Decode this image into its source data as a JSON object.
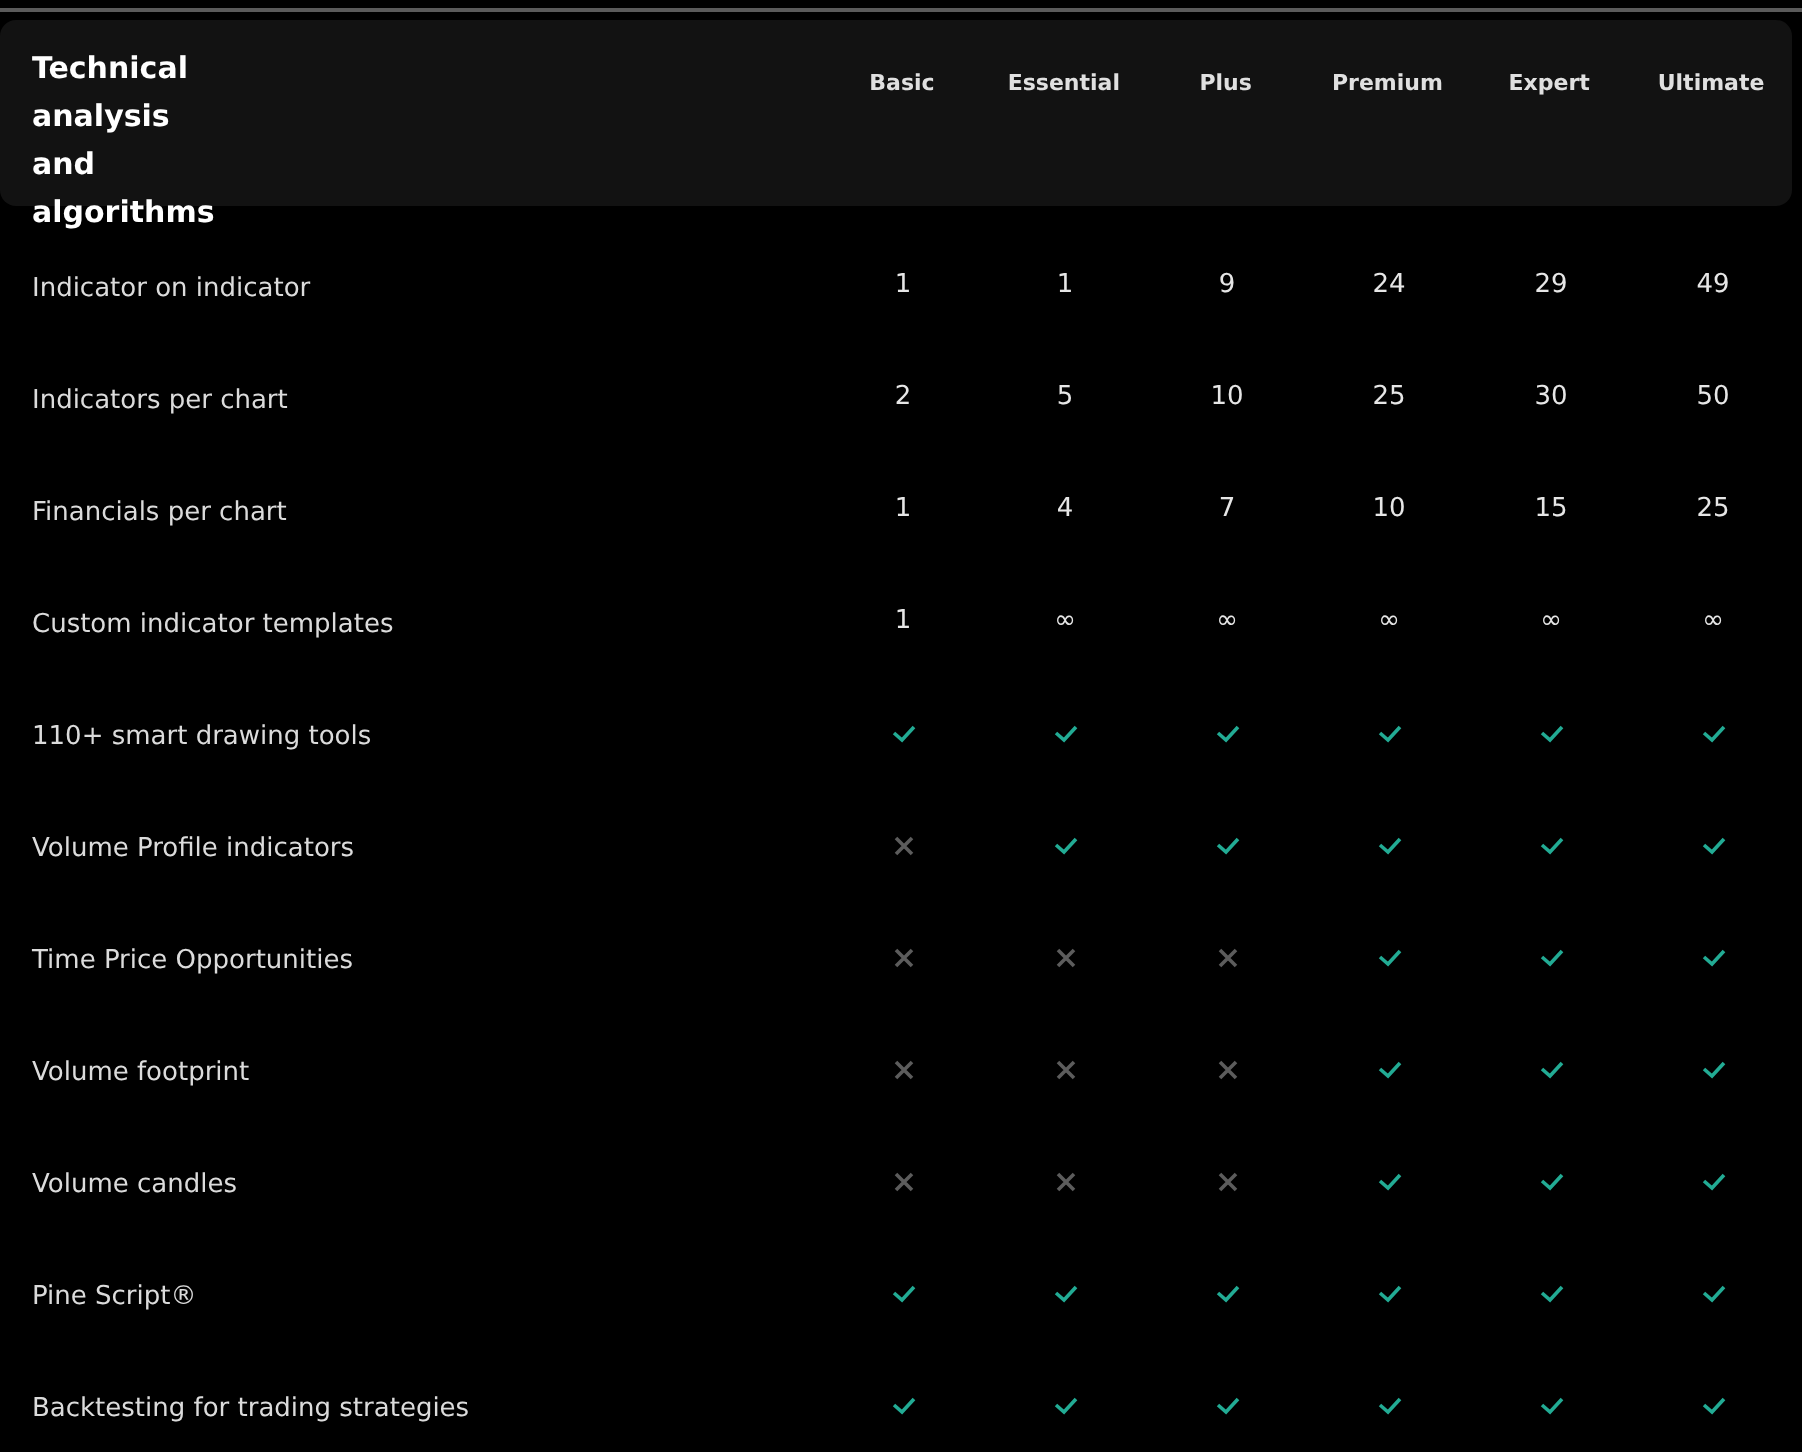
{
  "table": {
    "title": "Technical analysis and algorithms",
    "columns": [
      "Basic",
      "Essential",
      "Plus",
      "Premium",
      "Expert",
      "Ultimate"
    ],
    "rows": [
      {
        "label": "Indicator on indicator",
        "cells": [
          {
            "kind": "value",
            "text": "1"
          },
          {
            "kind": "value",
            "text": "1"
          },
          {
            "kind": "value",
            "text": "9"
          },
          {
            "kind": "value",
            "text": "24"
          },
          {
            "kind": "value",
            "text": "29"
          },
          {
            "kind": "value",
            "text": "49"
          }
        ]
      },
      {
        "label": "Indicators per chart",
        "cells": [
          {
            "kind": "value",
            "text": "2"
          },
          {
            "kind": "value",
            "text": "5"
          },
          {
            "kind": "value",
            "text": "10"
          },
          {
            "kind": "value",
            "text": "25"
          },
          {
            "kind": "value",
            "text": "30"
          },
          {
            "kind": "value",
            "text": "50"
          }
        ]
      },
      {
        "label": "Financials per chart",
        "cells": [
          {
            "kind": "value",
            "text": "1"
          },
          {
            "kind": "value",
            "text": "4"
          },
          {
            "kind": "value",
            "text": "7"
          },
          {
            "kind": "value",
            "text": "10"
          },
          {
            "kind": "value",
            "text": "15"
          },
          {
            "kind": "value",
            "text": "25"
          }
        ]
      },
      {
        "label": "Custom indicator templates",
        "cells": [
          {
            "kind": "value",
            "text": "1"
          },
          {
            "kind": "value",
            "text": "∞"
          },
          {
            "kind": "value",
            "text": "∞"
          },
          {
            "kind": "value",
            "text": "∞"
          },
          {
            "kind": "value",
            "text": "∞"
          },
          {
            "kind": "value",
            "text": "∞"
          }
        ]
      },
      {
        "label": "110+ smart drawing tools",
        "cells": [
          {
            "kind": "check"
          },
          {
            "kind": "check"
          },
          {
            "kind": "check"
          },
          {
            "kind": "check"
          },
          {
            "kind": "check"
          },
          {
            "kind": "check"
          }
        ]
      },
      {
        "label": "Volume Profile indicators",
        "cells": [
          {
            "kind": "cross"
          },
          {
            "kind": "check"
          },
          {
            "kind": "check"
          },
          {
            "kind": "check"
          },
          {
            "kind": "check"
          },
          {
            "kind": "check"
          }
        ]
      },
      {
        "label": "Time Price Opportunities",
        "cells": [
          {
            "kind": "cross"
          },
          {
            "kind": "cross"
          },
          {
            "kind": "cross"
          },
          {
            "kind": "check"
          },
          {
            "kind": "check"
          },
          {
            "kind": "check"
          }
        ]
      },
      {
        "label": "Volume footprint",
        "cells": [
          {
            "kind": "cross"
          },
          {
            "kind": "cross"
          },
          {
            "kind": "cross"
          },
          {
            "kind": "check"
          },
          {
            "kind": "check"
          },
          {
            "kind": "check"
          }
        ]
      },
      {
        "label": "Volume candles",
        "cells": [
          {
            "kind": "cross"
          },
          {
            "kind": "cross"
          },
          {
            "kind": "cross"
          },
          {
            "kind": "check"
          },
          {
            "kind": "check"
          },
          {
            "kind": "check"
          }
        ]
      },
      {
        "label": "Pine Script®",
        "cells": [
          {
            "kind": "check"
          },
          {
            "kind": "check"
          },
          {
            "kind": "check"
          },
          {
            "kind": "check"
          },
          {
            "kind": "check"
          },
          {
            "kind": "check"
          }
        ]
      },
      {
        "label": "Backtesting for trading strategies",
        "cells": [
          {
            "kind": "check"
          },
          {
            "kind": "check"
          },
          {
            "kind": "check"
          },
          {
            "kind": "check"
          },
          {
            "kind": "check"
          },
          {
            "kind": "check"
          }
        ]
      }
    ]
  }
}
